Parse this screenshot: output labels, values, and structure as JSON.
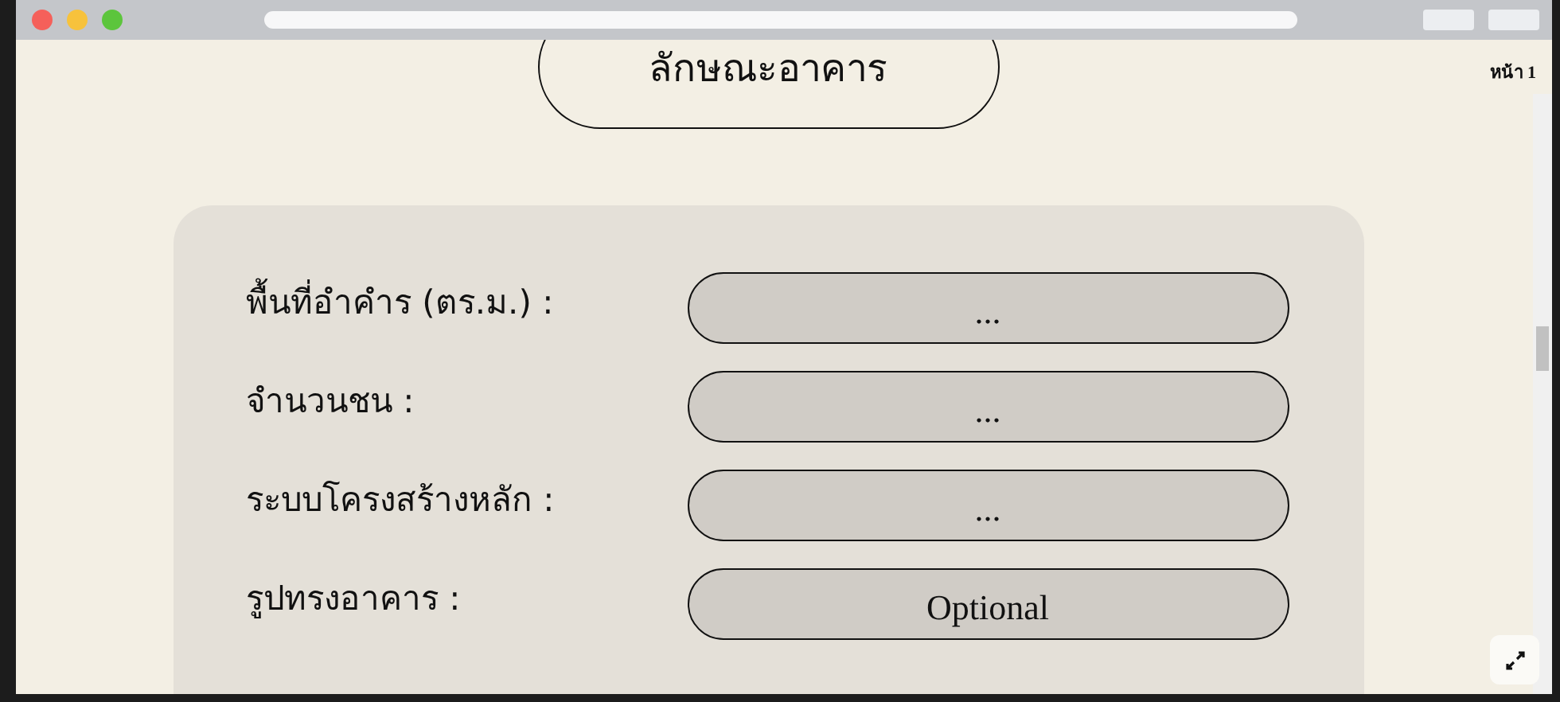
{
  "page_label": "หน้า 1",
  "title": "ลักษณะอาคาร",
  "fields": [
    {
      "label": "พื้นที่อำคำร (ตร.ม.) :",
      "value": "..."
    },
    {
      "label": "จำนวนชน :",
      "value": "..."
    },
    {
      "label": "ระบบโครงสร้างหลัก :",
      "value": "..."
    },
    {
      "label": "รูปทรงอาคาร  :",
      "value": "Optional"
    }
  ]
}
